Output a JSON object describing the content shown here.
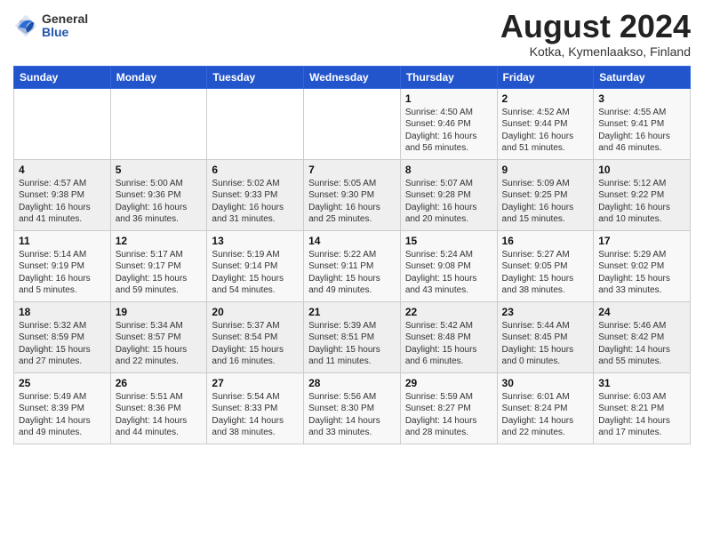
{
  "header": {
    "logo_general": "General",
    "logo_blue": "Blue",
    "month_year": "August 2024",
    "location": "Kotka, Kymenlaakso, Finland"
  },
  "weekdays": [
    "Sunday",
    "Monday",
    "Tuesday",
    "Wednesday",
    "Thursday",
    "Friday",
    "Saturday"
  ],
  "weeks": [
    [
      {
        "day": "",
        "sunrise": "",
        "sunset": "",
        "daylight": ""
      },
      {
        "day": "",
        "sunrise": "",
        "sunset": "",
        "daylight": ""
      },
      {
        "day": "",
        "sunrise": "",
        "sunset": "",
        "daylight": ""
      },
      {
        "day": "",
        "sunrise": "",
        "sunset": "",
        "daylight": ""
      },
      {
        "day": "1",
        "sunrise": "Sunrise: 4:50 AM",
        "sunset": "Sunset: 9:46 PM",
        "daylight": "Daylight: 16 hours and 56 minutes."
      },
      {
        "day": "2",
        "sunrise": "Sunrise: 4:52 AM",
        "sunset": "Sunset: 9:44 PM",
        "daylight": "Daylight: 16 hours and 51 minutes."
      },
      {
        "day": "3",
        "sunrise": "Sunrise: 4:55 AM",
        "sunset": "Sunset: 9:41 PM",
        "daylight": "Daylight: 16 hours and 46 minutes."
      }
    ],
    [
      {
        "day": "4",
        "sunrise": "Sunrise: 4:57 AM",
        "sunset": "Sunset: 9:38 PM",
        "daylight": "Daylight: 16 hours and 41 minutes."
      },
      {
        "day": "5",
        "sunrise": "Sunrise: 5:00 AM",
        "sunset": "Sunset: 9:36 PM",
        "daylight": "Daylight: 16 hours and 36 minutes."
      },
      {
        "day": "6",
        "sunrise": "Sunrise: 5:02 AM",
        "sunset": "Sunset: 9:33 PM",
        "daylight": "Daylight: 16 hours and 31 minutes."
      },
      {
        "day": "7",
        "sunrise": "Sunrise: 5:05 AM",
        "sunset": "Sunset: 9:30 PM",
        "daylight": "Daylight: 16 hours and 25 minutes."
      },
      {
        "day": "8",
        "sunrise": "Sunrise: 5:07 AM",
        "sunset": "Sunset: 9:28 PM",
        "daylight": "Daylight: 16 hours and 20 minutes."
      },
      {
        "day": "9",
        "sunrise": "Sunrise: 5:09 AM",
        "sunset": "Sunset: 9:25 PM",
        "daylight": "Daylight: 16 hours and 15 minutes."
      },
      {
        "day": "10",
        "sunrise": "Sunrise: 5:12 AM",
        "sunset": "Sunset: 9:22 PM",
        "daylight": "Daylight: 16 hours and 10 minutes."
      }
    ],
    [
      {
        "day": "11",
        "sunrise": "Sunrise: 5:14 AM",
        "sunset": "Sunset: 9:19 PM",
        "daylight": "Daylight: 16 hours and 5 minutes."
      },
      {
        "day": "12",
        "sunrise": "Sunrise: 5:17 AM",
        "sunset": "Sunset: 9:17 PM",
        "daylight": "Daylight: 15 hours and 59 minutes."
      },
      {
        "day": "13",
        "sunrise": "Sunrise: 5:19 AM",
        "sunset": "Sunset: 9:14 PM",
        "daylight": "Daylight: 15 hours and 54 minutes."
      },
      {
        "day": "14",
        "sunrise": "Sunrise: 5:22 AM",
        "sunset": "Sunset: 9:11 PM",
        "daylight": "Daylight: 15 hours and 49 minutes."
      },
      {
        "day": "15",
        "sunrise": "Sunrise: 5:24 AM",
        "sunset": "Sunset: 9:08 PM",
        "daylight": "Daylight: 15 hours and 43 minutes."
      },
      {
        "day": "16",
        "sunrise": "Sunrise: 5:27 AM",
        "sunset": "Sunset: 9:05 PM",
        "daylight": "Daylight: 15 hours and 38 minutes."
      },
      {
        "day": "17",
        "sunrise": "Sunrise: 5:29 AM",
        "sunset": "Sunset: 9:02 PM",
        "daylight": "Daylight: 15 hours and 33 minutes."
      }
    ],
    [
      {
        "day": "18",
        "sunrise": "Sunrise: 5:32 AM",
        "sunset": "Sunset: 8:59 PM",
        "daylight": "Daylight: 15 hours and 27 minutes."
      },
      {
        "day": "19",
        "sunrise": "Sunrise: 5:34 AM",
        "sunset": "Sunset: 8:57 PM",
        "daylight": "Daylight: 15 hours and 22 minutes."
      },
      {
        "day": "20",
        "sunrise": "Sunrise: 5:37 AM",
        "sunset": "Sunset: 8:54 PM",
        "daylight": "Daylight: 15 hours and 16 minutes."
      },
      {
        "day": "21",
        "sunrise": "Sunrise: 5:39 AM",
        "sunset": "Sunset: 8:51 PM",
        "daylight": "Daylight: 15 hours and 11 minutes."
      },
      {
        "day": "22",
        "sunrise": "Sunrise: 5:42 AM",
        "sunset": "Sunset: 8:48 PM",
        "daylight": "Daylight: 15 hours and 6 minutes."
      },
      {
        "day": "23",
        "sunrise": "Sunrise: 5:44 AM",
        "sunset": "Sunset: 8:45 PM",
        "daylight": "Daylight: 15 hours and 0 minutes."
      },
      {
        "day": "24",
        "sunrise": "Sunrise: 5:46 AM",
        "sunset": "Sunset: 8:42 PM",
        "daylight": "Daylight: 14 hours and 55 minutes."
      }
    ],
    [
      {
        "day": "25",
        "sunrise": "Sunrise: 5:49 AM",
        "sunset": "Sunset: 8:39 PM",
        "daylight": "Daylight: 14 hours and 49 minutes."
      },
      {
        "day": "26",
        "sunrise": "Sunrise: 5:51 AM",
        "sunset": "Sunset: 8:36 PM",
        "daylight": "Daylight: 14 hours and 44 minutes."
      },
      {
        "day": "27",
        "sunrise": "Sunrise: 5:54 AM",
        "sunset": "Sunset: 8:33 PM",
        "daylight": "Daylight: 14 hours and 38 minutes."
      },
      {
        "day": "28",
        "sunrise": "Sunrise: 5:56 AM",
        "sunset": "Sunset: 8:30 PM",
        "daylight": "Daylight: 14 hours and 33 minutes."
      },
      {
        "day": "29",
        "sunrise": "Sunrise: 5:59 AM",
        "sunset": "Sunset: 8:27 PM",
        "daylight": "Daylight: 14 hours and 28 minutes."
      },
      {
        "day": "30",
        "sunrise": "Sunrise: 6:01 AM",
        "sunset": "Sunset: 8:24 PM",
        "daylight": "Daylight: 14 hours and 22 minutes."
      },
      {
        "day": "31",
        "sunrise": "Sunrise: 6:03 AM",
        "sunset": "Sunset: 8:21 PM",
        "daylight": "Daylight: 14 hours and 17 minutes."
      }
    ]
  ]
}
